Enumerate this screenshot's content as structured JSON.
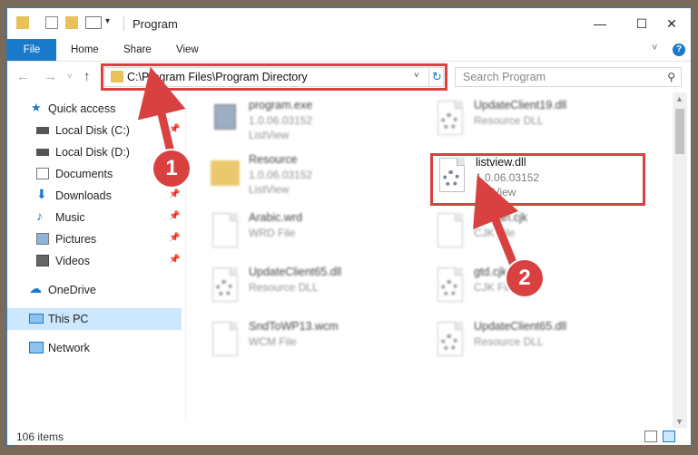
{
  "window": {
    "title": "Program"
  },
  "ribbon": {
    "tabs": [
      "File",
      "Home",
      "Share",
      "View"
    ],
    "help": "?"
  },
  "address": {
    "path": "C:\\Program Files\\Program Directory",
    "dropdown": "˅",
    "refresh": "↻"
  },
  "search": {
    "placeholder": "Search Program",
    "icon": "search-icon"
  },
  "sidebar": {
    "items": [
      {
        "label": "Quick access",
        "icon": "star-icon",
        "pinned": false
      },
      {
        "label": "Local Disk (C:)",
        "icon": "drive-icon",
        "pinned": true
      },
      {
        "label": "Local Disk (D:)",
        "icon": "drive-icon",
        "pinned": false
      },
      {
        "label": "Documents",
        "icon": "documents-icon",
        "pinned": true
      },
      {
        "label": "Downloads",
        "icon": "download-icon",
        "pinned": true
      },
      {
        "label": "Music",
        "icon": "music-icon",
        "pinned": true
      },
      {
        "label": "Pictures",
        "icon": "pictures-icon",
        "pinned": true
      },
      {
        "label": "Videos",
        "icon": "videos-icon",
        "pinned": true
      },
      {
        "label": "OneDrive",
        "icon": "cloud-icon",
        "pinned": false
      },
      {
        "label": "This PC",
        "icon": "computer-icon",
        "pinned": false
      },
      {
        "label": "Network",
        "icon": "network-icon",
        "pinned": false
      }
    ]
  },
  "files": [
    {
      "name": "program.exe",
      "line2": "1.0.06.03152",
      "line3": "ListView",
      "type": "exe"
    },
    {
      "name": "UpdateClient19.dll",
      "line2": "Resource DLL",
      "line3": "",
      "type": "dll"
    },
    {
      "name": "Resource",
      "line2": "1.0.06.03152",
      "line3": "ListView",
      "type": "folder"
    },
    {
      "name": "listview.dll",
      "line2": "1.0.06.03152",
      "line3": "ListView",
      "type": "dll"
    },
    {
      "name": "Arabic.wrd",
      "line2": "WRD File",
      "line3": "",
      "type": "doc"
    },
    {
      "name": "Korean.cjk",
      "line2": "CJK File",
      "line3": "",
      "type": "doc"
    },
    {
      "name": "UpdateClient65.dll",
      "line2": "Resource DLL",
      "line3": "",
      "type": "dll"
    },
    {
      "name": "gtd.cjk",
      "line2": "CJK File",
      "line3": "",
      "type": "doc"
    },
    {
      "name": "SndToWP13.wcm",
      "line2": "WCM File",
      "line3": "",
      "type": "doc"
    },
    {
      "name": "UpdateClient65.dll",
      "line2": "Resource DLL",
      "line3": "",
      "type": "dll"
    }
  ],
  "status": {
    "count": "106 items"
  },
  "annotations": {
    "step1": "1",
    "step2": "2"
  },
  "colors": {
    "accent": "#1979ca",
    "highlight": "#d94141",
    "selected": "#cce8ff"
  }
}
